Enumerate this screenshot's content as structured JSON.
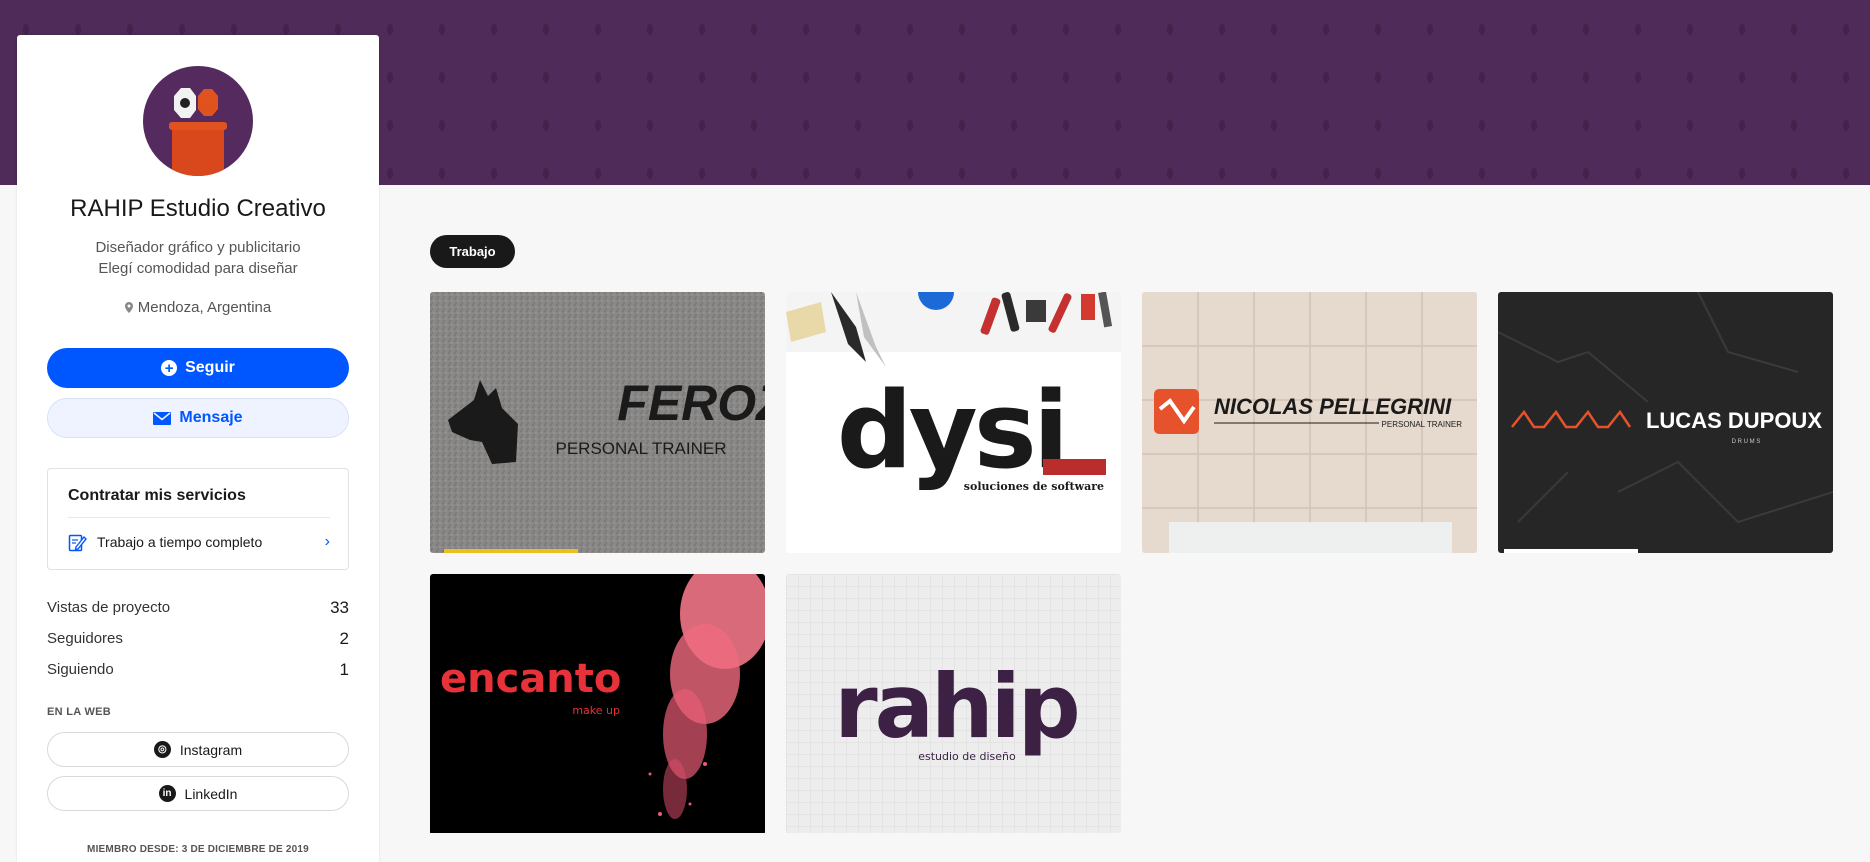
{
  "profile": {
    "name": "RAHIP Estudio Creativo",
    "occupation_line1": "Diseñador gráfico y publicitario",
    "occupation_line2": "Elegí comodidad para diseñar",
    "location": "Mendoza, Argentina"
  },
  "actions": {
    "follow_label": "Seguir",
    "message_label": "Mensaje"
  },
  "hire": {
    "title": "Contratar mis servicios",
    "item_label": "Trabajo a tiempo completo"
  },
  "stats": [
    {
      "label": "Vistas de proyecto",
      "value": "33"
    },
    {
      "label": "Seguidores",
      "value": "2"
    },
    {
      "label": "Siguiendo",
      "value": "1"
    }
  ],
  "web": {
    "title": "EN LA WEB",
    "links": [
      {
        "label": "Instagram",
        "icon": "instagram-icon"
      },
      {
        "label": "LinkedIn",
        "icon": "linkedin-icon"
      }
    ]
  },
  "member_since": "MIEMBRO DESDE: 3 DE DICIEMBRE DE 2019",
  "tabs": [
    {
      "label": "Trabajo",
      "active": true
    }
  ],
  "projects": [
    {
      "brand": "FEROZ",
      "tagline": "PERSONAL TRAINER"
    },
    {
      "brand": "dysi",
      "tagline": "soluciones de software"
    },
    {
      "brand": "NICOLAS PELLEGRINI",
      "tagline": "PERSONAL TRAINER"
    },
    {
      "brand": "LUCAS DUPOUX",
      "tagline": "D R U M S"
    },
    {
      "brand": "encanto",
      "tagline": "make up"
    },
    {
      "brand": "rahip",
      "tagline": "estudio de diseño"
    }
  ],
  "colors": {
    "banner": "#4e2b58",
    "accent": "#0057ff",
    "tab_bg": "#191919"
  }
}
